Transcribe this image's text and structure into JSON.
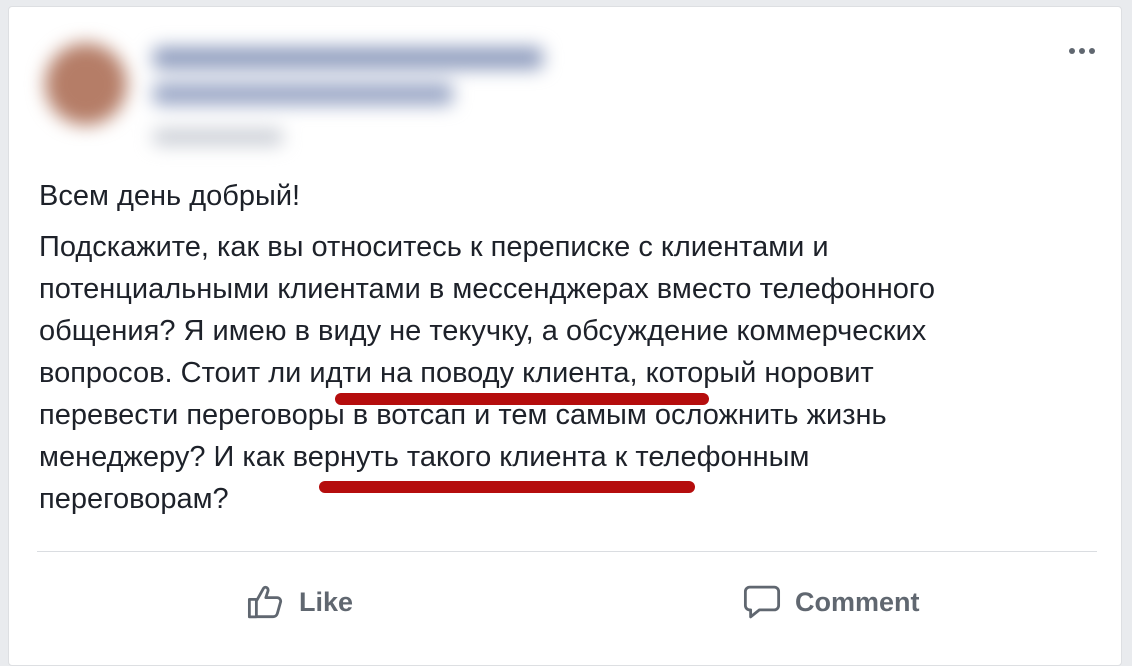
{
  "post": {
    "greeting": "Всем день добрый!",
    "body_lines": [
      "Подскажите, как вы относитесь к переписке с клиентами и",
      "потенциальными клиентами в мессенджерах вместо телефонного",
      "общения? Я имею в виду не текучку, а обсуждение коммерческих",
      "вопросов. Стоит ли идти на поводу клиента, который норовит",
      "перевести переговоры в вотсап и тем самым осложнить жизнь",
      "менеджеру? И как вернуть такого клиента к телефонным",
      "переговорам?"
    ],
    "highlighted_phrases": [
      "идти на поводу клиента",
      "вернуть такого клиента"
    ]
  },
  "actions": {
    "like_label": "Like",
    "comment_label": "Comment"
  },
  "icons": {
    "more": "more-options-icon",
    "like": "thumbs-up-icon",
    "comment": "speech-bubble-icon"
  },
  "colors": {
    "underline": "#b50d0d",
    "text": "#1d2129",
    "action_text": "#606770"
  }
}
